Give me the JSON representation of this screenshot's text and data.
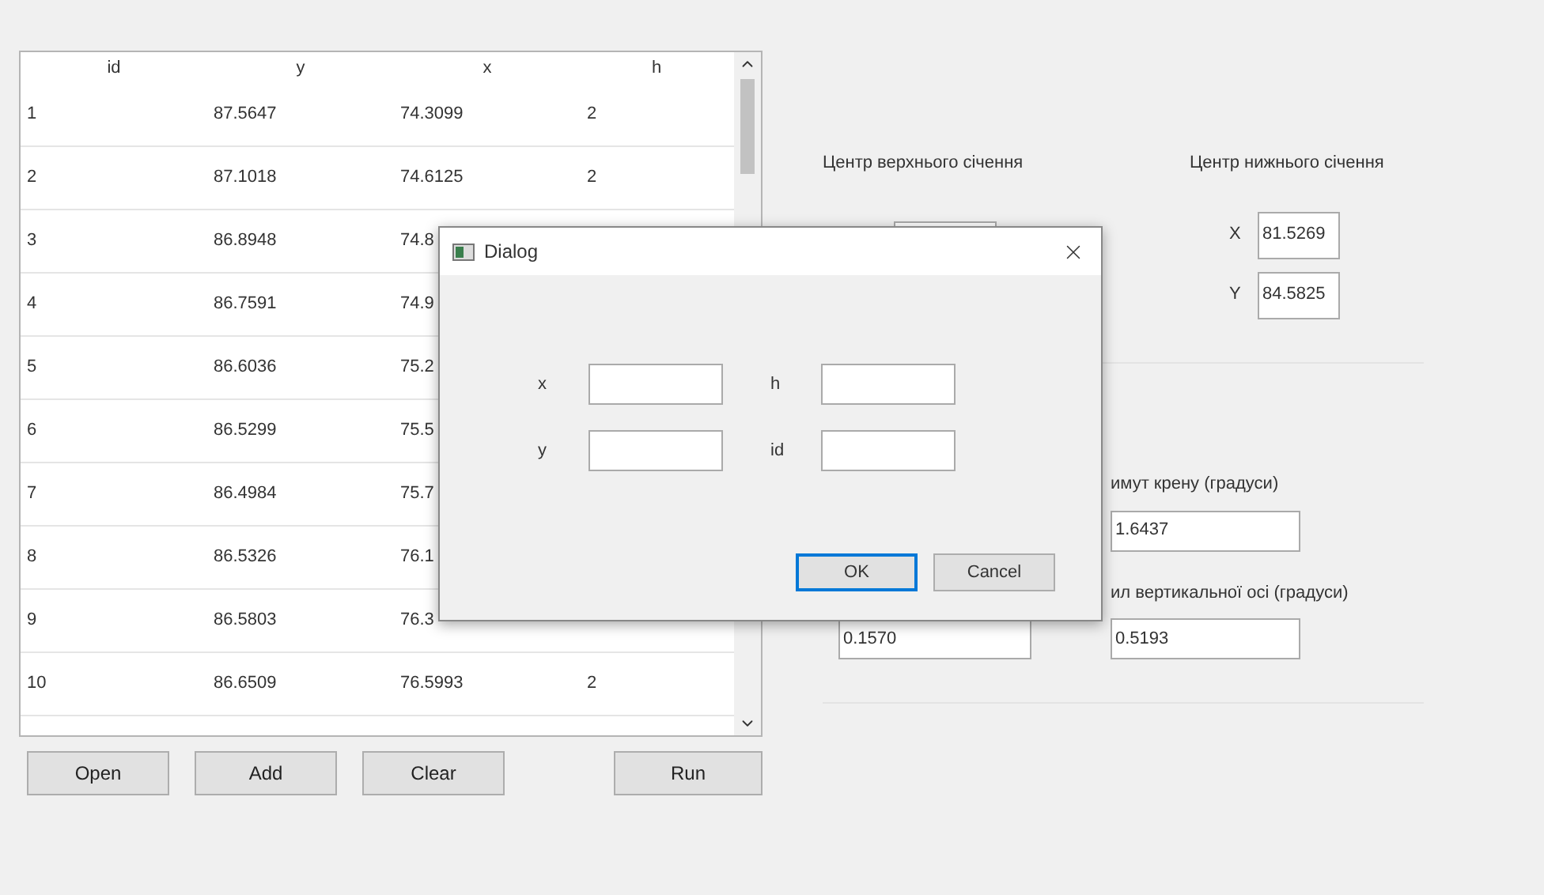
{
  "table": {
    "columns": [
      "id",
      "y",
      "x",
      "h"
    ],
    "rows": [
      {
        "cells": [
          "1",
          "87.5647",
          "74.3099",
          "2"
        ]
      },
      {
        "cells": [
          "2",
          "87.1018",
          "74.6125",
          "2"
        ]
      },
      {
        "cells": [
          "3",
          "86.8948",
          "74.8",
          ""
        ]
      },
      {
        "cells": [
          "4",
          "86.7591",
          "74.9",
          ""
        ]
      },
      {
        "cells": [
          "5",
          "86.6036",
          "75.2",
          ""
        ]
      },
      {
        "cells": [
          "6",
          "86.5299",
          "75.5",
          ""
        ]
      },
      {
        "cells": [
          "7",
          "86.4984",
          "75.7",
          ""
        ]
      },
      {
        "cells": [
          "8",
          "86.5326",
          "76.1",
          ""
        ]
      },
      {
        "cells": [
          "9",
          "86.5803",
          "76.3",
          ""
        ]
      },
      {
        "cells": [
          "10",
          "86.6509",
          "76.5993",
          "2"
        ]
      }
    ]
  },
  "buttons": [
    "Open",
    "Add",
    "Clear"
  ],
  "run_button": "Run",
  "upper_center": {
    "title": "Центр верхнього січення"
  },
  "lower_center": {
    "title": "Центр нижнього січення",
    "fields": [
      {
        "label": "X",
        "value": "81.5269"
      },
      {
        "label": "Y",
        "value": "84.5825"
      }
    ]
  },
  "angles": [
    {
      "title": "имут крену (градуси)",
      "value": "1.6437"
    },
    {
      "title": "ил вертикальної осі (градуси)",
      "left_value": "0.1570",
      "value": "0.5193"
    }
  ],
  "dialog": {
    "title": "Dialog",
    "fields": [
      {
        "label": "x"
      },
      {
        "label": "h"
      },
      {
        "label": "y"
      },
      {
        "label": "id"
      }
    ],
    "buttons": [
      {
        "label": "OK",
        "focused": true
      },
      {
        "label": "Cancel",
        "focused": false
      }
    ]
  }
}
